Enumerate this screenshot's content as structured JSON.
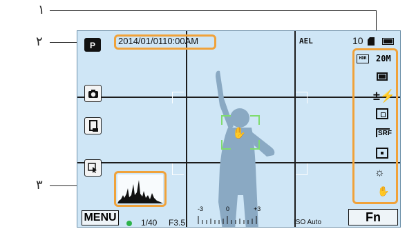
{
  "callouts": [
    "١",
    "٢",
    "٣"
  ],
  "status": {
    "datetime": "2014/01/0110:00AM",
    "ael": "AEL",
    "shots_remaining": "10"
  },
  "left_icons": [
    "camera-mode-p-icon",
    "smart-filter-icon",
    "display-off-icon",
    "touch-af-icon"
  ],
  "right_icons": [
    "HDR",
    "20M",
    "quality",
    "flash",
    "metering",
    "SRF",
    "af-area",
    "white-balance",
    "ois"
  ],
  "right_labels": {
    "hdr": "HDR",
    "size": "20M",
    "srf": "SRF"
  },
  "bottom": {
    "menu": "MENU",
    "shutter": "1/40",
    "aperture": "F3.5",
    "ev_minus": "-3",
    "ev_zero": "0",
    "ev_plus": "+3",
    "iso": "ISO Auto",
    "fn": "Fn"
  },
  "colors": {
    "screen": "#cfe6f6",
    "highlight": "#f0a23a",
    "focus_green": "#7fdc6e",
    "status_dot": "#2db34a"
  }
}
